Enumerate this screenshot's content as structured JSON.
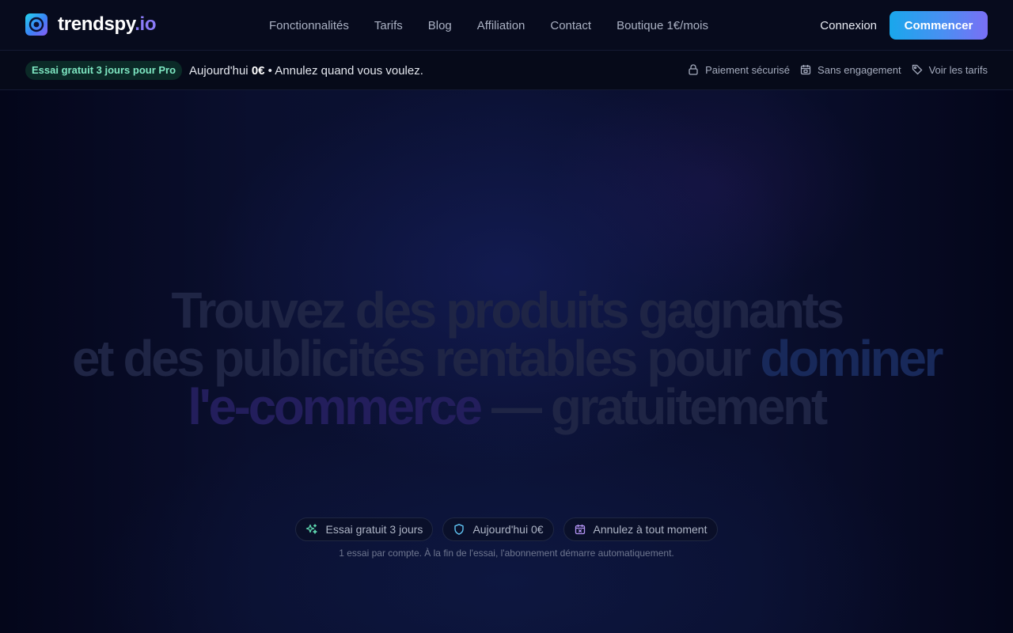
{
  "nav": {
    "logo": {
      "name": "trendspy",
      "tld": ".io"
    },
    "links": [
      {
        "label": "Fonctionnalités"
      },
      {
        "label": "Tarifs"
      },
      {
        "label": "Blog"
      },
      {
        "label": "Affiliation"
      },
      {
        "label": "Contact"
      },
      {
        "label": "Boutique 1€/mois"
      }
    ],
    "login_label": "Connexion",
    "cta_label": "Commencer"
  },
  "promo": {
    "badge": "Essai gratuit 3 jours pour Pro",
    "text_prefix": "Aujourd'hui",
    "text_amount": "0€",
    "text_suffix": "• Annulez quand vous voulez.",
    "items": [
      {
        "icon": "lock-icon",
        "label": "Paiement sécurisé"
      },
      {
        "icon": "calendar-icon",
        "label": "Sans engagement"
      },
      {
        "icon": "tag-icon",
        "label": "Voir les tarifs"
      }
    ]
  },
  "hero": {
    "headline": {
      "line1": "Trouvez des produits gagnants",
      "line2_main": "et des publicités rentables pour",
      "line2_accent": "dominer",
      "line3_accent": "l'e-commerce",
      "line3_main": "— gratuitement"
    },
    "chips": [
      {
        "icon": "sparkles-icon",
        "label": "Essai gratuit 3 jours"
      },
      {
        "icon": "shield-icon",
        "label": "Aujourd'hui 0€"
      },
      {
        "icon": "calendar-x-icon",
        "label": "Annulez à tout moment"
      }
    ],
    "disclaimer": "1 essai par compte. À la fin de l'essai, l'abonnement démarre automatiquement."
  },
  "colors": {
    "accent_gradient_start": "#19a7ec",
    "accent_gradient_end": "#7a6ff5",
    "badge_green": "#7ee7c2",
    "background": "#05081a"
  }
}
